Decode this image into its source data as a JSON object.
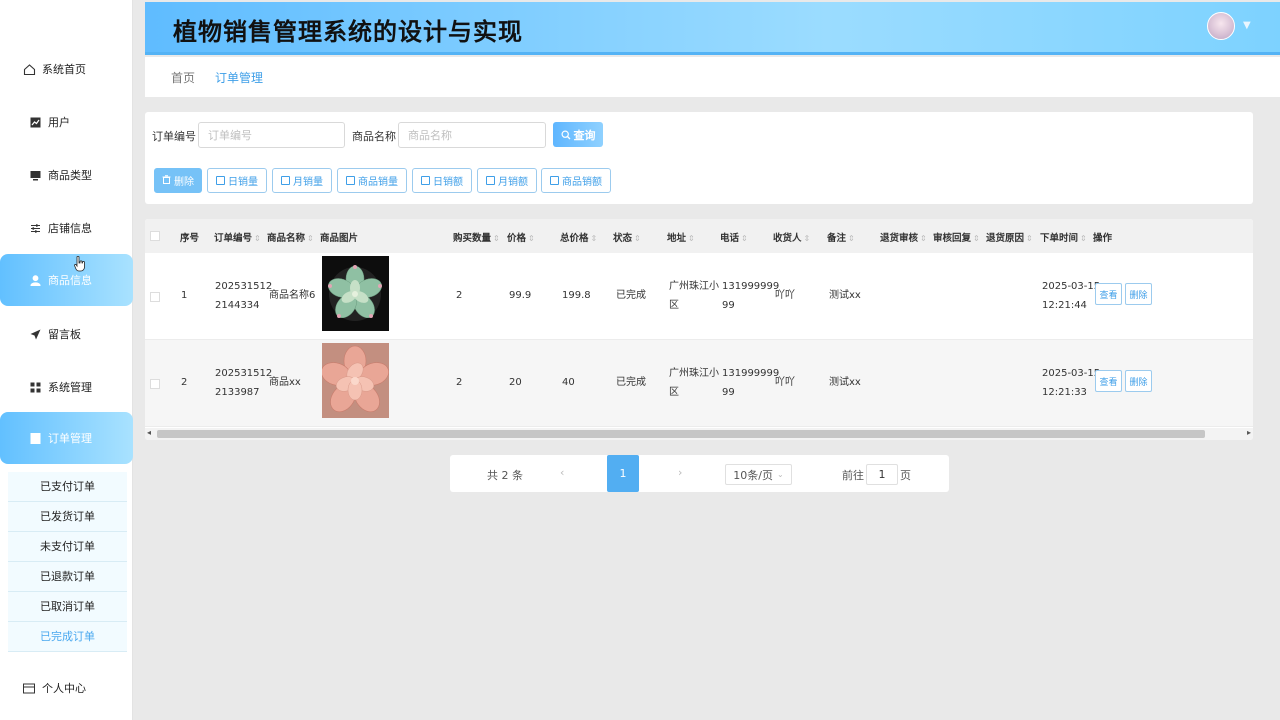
{
  "header": {
    "title": "植物销售管理系统的设计与实现"
  },
  "sidebar": {
    "items": [
      {
        "label": "系统首页",
        "icon": "home-icon"
      },
      {
        "label": "用户",
        "icon": "chart-icon"
      },
      {
        "label": "商品类型",
        "icon": "monitor-icon"
      },
      {
        "label": "店铺信息",
        "icon": "sliders-icon"
      },
      {
        "label": "商品信息",
        "icon": "user-icon"
      },
      {
        "label": "留言板",
        "icon": "send-icon"
      },
      {
        "label": "系统管理",
        "icon": "grid-icon"
      },
      {
        "label": "订单管理",
        "icon": "document-icon"
      },
      {
        "label": "个人中心",
        "icon": "card-icon"
      }
    ],
    "submenu": [
      "已支付订单",
      "已发货订单",
      "未支付订单",
      "已退款订单",
      "已取消订单",
      "已完成订单"
    ]
  },
  "breadcrumb": {
    "home": "首页",
    "current": "订单管理"
  },
  "search": {
    "order_no_label": "订单编号",
    "order_no_placeholder": "订单编号",
    "product_name_label": "商品名称",
    "product_name_placeholder": "商品名称",
    "search_button": "查询"
  },
  "toolbar": [
    "删除",
    "日销量",
    "月销量",
    "商品销量",
    "日销额",
    "月销额",
    "商品销额"
  ],
  "table": {
    "columns": [
      "序号",
      "订单编号",
      "商品名称",
      "商品图片",
      "购买数量",
      "价格",
      "总价格",
      "状态",
      "地址",
      "电话",
      "收货人",
      "备注",
      "退货审核",
      "审核回复",
      "退货原因",
      "下单时间",
      "操作"
    ],
    "rows": [
      {
        "index": "1",
        "order_no_1": "202531512",
        "order_no_2": "2144334",
        "product_name": "商品名称6",
        "quantity": "2",
        "price": "99.9",
        "total": "199.8",
        "status": "已完成",
        "address_1": "广州珠江小",
        "address_2": "区",
        "phone_1": "131999999",
        "phone_2": "99",
        "receiver": "吖吖",
        "remark": "测试xx",
        "date": "2025-03-15",
        "time": "12:21:44",
        "view": "查看",
        "delete": "删除"
      },
      {
        "index": "2",
        "order_no_1": "202531512",
        "order_no_2": "2133987",
        "product_name": "商品xx",
        "quantity": "2",
        "price": "20",
        "total": "40",
        "status": "已完成",
        "address_1": "广州珠江小",
        "address_2": "区",
        "phone_1": "131999999",
        "phone_2": "99",
        "receiver": "吖吖",
        "remark": "测试xx",
        "date": "2025-03-15",
        "time": "12:21:33",
        "view": "查看",
        "delete": "删除"
      }
    ]
  },
  "pagination": {
    "total": "共 2 条",
    "current_page": "1",
    "page_size": "10条/页",
    "goto_label": "前往",
    "goto_value": "1",
    "goto_suffix": "页"
  },
  "colors": {
    "accent": "#52aef2",
    "header_start": "#5fbcff",
    "header_end": "#9bdcff"
  }
}
